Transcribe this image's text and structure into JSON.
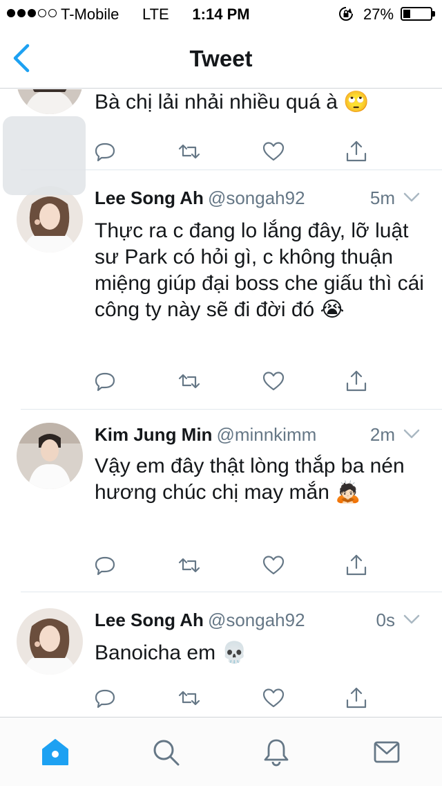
{
  "status_bar": {
    "carrier": "T-Mobile",
    "network": "LTE",
    "time": "1:14 PM",
    "battery": "27%",
    "battery_level": 0.27,
    "signal_bars": 3,
    "signal_total": 5
  },
  "nav": {
    "title": "Tweet",
    "back_icon": "chevron-left-icon"
  },
  "colors": {
    "accent": "#1da1f2",
    "icon_gray": "#657786",
    "text": "#14171a",
    "divider": "#e1e8ed"
  },
  "tweets": [
    {
      "text": "Bà chị lải nhải nhiều quá à 🙄"
    },
    {
      "name": "Lee Song Ah",
      "handle": "@songah92",
      "time": "5m",
      "text": "Thực ra c đang lo lắng đây, lỡ luật sư Park có hỏi gì, c không thuận miệng giúp đại boss che giấu thì cái công ty này sẽ đi đời đó 😭"
    },
    {
      "name": "Kim Jung Min",
      "handle": "@minnkimm",
      "time": "2m",
      "text": "Vậy em đây thật lòng thắp ba nén hương chúc chị may mắn 🙇🏻"
    },
    {
      "name": "Lee Song Ah",
      "handle": "@songah92",
      "time": "0s",
      "text": "Banoicha em 💀"
    }
  ],
  "tabs": [
    "home-icon",
    "search-icon",
    "notifications-icon",
    "messages-icon"
  ],
  "active_tab": "home-icon"
}
